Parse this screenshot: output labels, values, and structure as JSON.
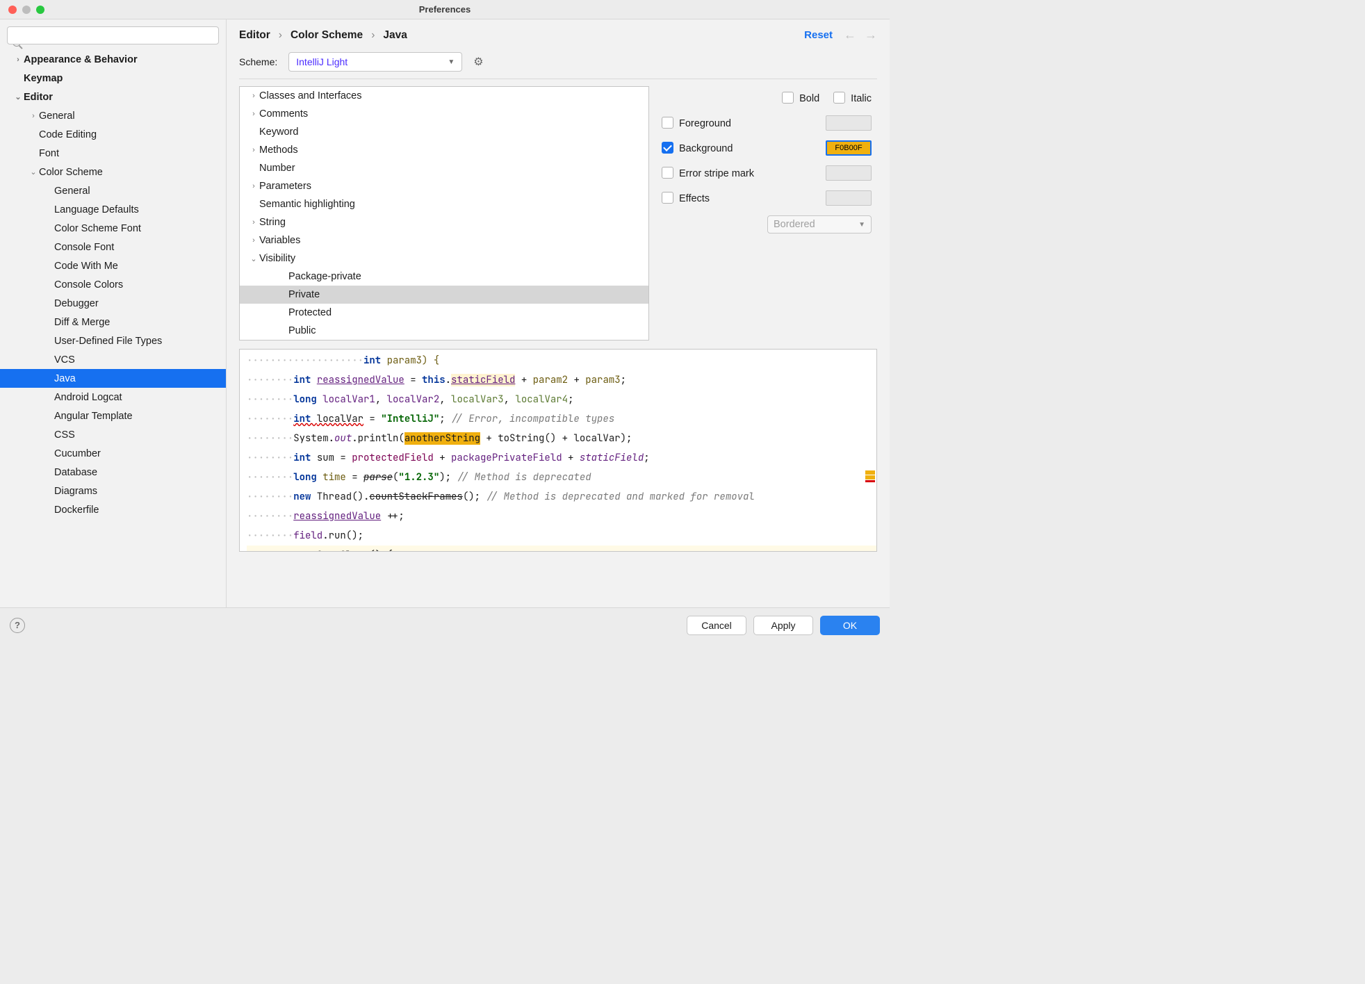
{
  "window": {
    "title": "Preferences"
  },
  "sidebar": {
    "items": [
      {
        "label": "Appearance & Behavior",
        "chev": "›",
        "bold": true,
        "ind": 0
      },
      {
        "label": "Keymap",
        "chev": "",
        "bold": true,
        "ind": 0
      },
      {
        "label": "Editor",
        "chev": "⌄",
        "bold": true,
        "ind": 0
      },
      {
        "label": "General",
        "chev": "›",
        "bold": false,
        "ind": 1
      },
      {
        "label": "Code Editing",
        "chev": "",
        "bold": false,
        "ind": 1
      },
      {
        "label": "Font",
        "chev": "",
        "bold": false,
        "ind": 1
      },
      {
        "label": "Color Scheme",
        "chev": "⌄",
        "bold": false,
        "ind": 1
      },
      {
        "label": "General",
        "chev": "",
        "bold": false,
        "ind": 2
      },
      {
        "label": "Language Defaults",
        "chev": "",
        "bold": false,
        "ind": 2
      },
      {
        "label": "Color Scheme Font",
        "chev": "",
        "bold": false,
        "ind": 2
      },
      {
        "label": "Console Font",
        "chev": "",
        "bold": false,
        "ind": 2
      },
      {
        "label": "Code With Me",
        "chev": "",
        "bold": false,
        "ind": 2
      },
      {
        "label": "Console Colors",
        "chev": "",
        "bold": false,
        "ind": 2
      },
      {
        "label": "Debugger",
        "chev": "",
        "bold": false,
        "ind": 2
      },
      {
        "label": "Diff & Merge",
        "chev": "",
        "bold": false,
        "ind": 2
      },
      {
        "label": "User-Defined File Types",
        "chev": "",
        "bold": false,
        "ind": 2
      },
      {
        "label": "VCS",
        "chev": "",
        "bold": false,
        "ind": 2
      },
      {
        "label": "Java",
        "chev": "",
        "bold": false,
        "ind": 2,
        "selected": true
      },
      {
        "label": "Android Logcat",
        "chev": "",
        "bold": false,
        "ind": 2
      },
      {
        "label": "Angular Template",
        "chev": "",
        "bold": false,
        "ind": 2
      },
      {
        "label": "CSS",
        "chev": "",
        "bold": false,
        "ind": 2
      },
      {
        "label": "Cucumber",
        "chev": "",
        "bold": false,
        "ind": 2
      },
      {
        "label": "Database",
        "chev": "",
        "bold": false,
        "ind": 2
      },
      {
        "label": "Diagrams",
        "chev": "",
        "bold": false,
        "ind": 2
      },
      {
        "label": "Dockerfile",
        "chev": "",
        "bold": false,
        "ind": 2
      }
    ]
  },
  "breadcrumb": {
    "a": "Editor",
    "b": "Color Scheme",
    "c": "Java",
    "reset": "Reset"
  },
  "scheme": {
    "label": "Scheme:",
    "value": "IntelliJ Light"
  },
  "categories": [
    {
      "label": "Classes and Interfaces",
      "chev": "›",
      "ind": 0
    },
    {
      "label": "Comments",
      "chev": "›",
      "ind": 0
    },
    {
      "label": "Keyword",
      "chev": "",
      "ind": 0
    },
    {
      "label": "Methods",
      "chev": "›",
      "ind": 0
    },
    {
      "label": "Number",
      "chev": "",
      "ind": 0
    },
    {
      "label": "Parameters",
      "chev": "›",
      "ind": 0
    },
    {
      "label": "Semantic highlighting",
      "chev": "",
      "ind": 0
    },
    {
      "label": "String",
      "chev": "›",
      "ind": 0
    },
    {
      "label": "Variables",
      "chev": "›",
      "ind": 0
    },
    {
      "label": "Visibility",
      "chev": "⌄",
      "ind": 0
    },
    {
      "label": "Package-private",
      "chev": "",
      "ind": 1
    },
    {
      "label": "Private",
      "chev": "",
      "ind": 1,
      "sel": true
    },
    {
      "label": "Protected",
      "chev": "",
      "ind": 1
    },
    {
      "label": "Public",
      "chev": "",
      "ind": 1
    }
  ],
  "opts": {
    "bold": "Bold",
    "italic": "Italic",
    "foreground": "Foreground",
    "background": "Background",
    "bg_value": "F0B00F",
    "errstripe": "Error stripe mark",
    "effects": "Effects",
    "effects_dd": "Bordered"
  },
  "code": {
    "l1a": "int",
    "l1b": " param3) {",
    "l2a": "int ",
    "l2b": "reassignedValue",
    "l2c": " = ",
    "l2d": "this",
    "l2e": ".",
    "l2f": "staticField",
    "l2g": " + ",
    "l2h": "param2",
    "l2i": " + ",
    "l2j": "param3",
    "l2k": ";",
    "l3a": "long ",
    "l3b": "localVar1",
    "l3c": ", ",
    "l3d": "localVar2",
    "l3e": ", ",
    "l3f": "localVar3",
    "l3g": ", ",
    "l3h": "localVar4",
    "l3i": ";",
    "l4a": "int ",
    "l4b": "localVar",
    "l4c": " = ",
    "l4d": "\"IntelliJ\"",
    "l4e": "; ",
    "l4f": "// Error, incompatible types",
    "l5a": "System.",
    "l5b": "out",
    "l5c": ".println(",
    "l5d": "anotherString",
    "l5e": " + toString() + ",
    "l5f": "localVar",
    "l5g": ");",
    "l6a": "int ",
    "l6b": "sum",
    "l6c": " = ",
    "l6d": "protectedField",
    "l6e": " + ",
    "l6f": "packagePrivateField",
    "l6g": " + ",
    "l6h": "staticField",
    "l6i": ";",
    "l7a": "long ",
    "l7b": "time",
    "l7c": " = ",
    "l7d": "parse",
    "l7e": "(",
    "l7f": "\"1.2.3\"",
    "l7g": "); ",
    "l7h": "// Method is deprecated",
    "l8a": "new",
    "l8b": " Thread().",
    "l8c": "countStackFrames",
    "l8d": "(); ",
    "l8e": "// Method is deprecated and marked for removal",
    "l9a": "reassignedValue",
    "l9b": " ++;",
    "l10a": "field",
    "l10b": ".run();",
    "l11a": "new",
    "l11b": " SomeClass() {"
  },
  "footer": {
    "cancel": "Cancel",
    "apply": "Apply",
    "ok": "OK"
  }
}
